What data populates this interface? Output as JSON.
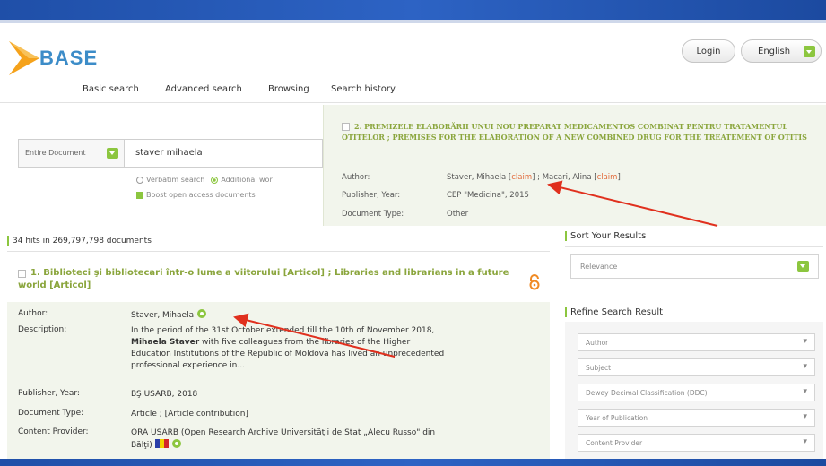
{
  "header": {
    "logo_text": "BASE",
    "login_label": "Login",
    "language_label": "English"
  },
  "nav": {
    "items": [
      "Basic search",
      "Advanced search",
      "Browsing",
      "Search history"
    ]
  },
  "search": {
    "scope": "Entire Document",
    "query": "staver mihaela",
    "options": {
      "verbatim": "Verbatim search",
      "additional": "Additional wor",
      "boost": "Boost open access documents"
    }
  },
  "overlay_record": {
    "title": "2. PREMIZELE ELABORĂRII UNUI NOU PREPARAT MEDICAMENTOS COMBINAT PENTRU TRATAMENTUL OTITELOR ; PREMISES FOR THE ELABORATION OF A NEW COMBINED DRUG FOR THE TREATEMENT OF OTITIS",
    "author_label": "Author:",
    "author_1": "Staver, Mihaela",
    "author_2": "Macari, Alina",
    "claim_label": "claim",
    "publisher_label": "Publisher, Year:",
    "publisher_value": "CEP \"Medicina\", 2015",
    "doctype_label": "Document Type:",
    "doctype_value": "Other"
  },
  "results": {
    "hits_text": "34 hits in 269,797,798 documents",
    "first": {
      "title": "1. Biblioteci şi bibliotecari într-o lume a viitorului [Articol] ; Libraries and librarians in a future world [Articol]",
      "author_label": "Author:",
      "author_value": "Staver, Mihaela",
      "description_label": "Description:",
      "description_lead": "In the period of the 31st October extended till the 10th of November 2018,",
      "description_bold": "Mihaela Staver",
      "description_rest_1": " with five colleagues from the libraries of the Higher",
      "description_rest_2": "Education Institutions of the Republic of Moldova has lived an unprecedented",
      "description_rest_3": "professional experience in...",
      "publisher_label": "Publisher, Year:",
      "publisher_value": "BŞ USARB, 2018",
      "doctype_label": "Document Type:",
      "doctype_value": "Article ; [Article contribution]",
      "provider_label": "Content Provider:",
      "provider_value_1": "ORA USARB (Open Research Archive Universităţii de Stat „Alecu Russo\" din",
      "provider_value_2": "Bălţi)"
    }
  },
  "sidebar": {
    "sort_heading": "Sort Your Results",
    "sort_value": "Relevance",
    "refine_heading": "Refine Search Result",
    "facets": [
      "Author",
      "Subject",
      "Dewey Decimal Classification (DDC)",
      "Year of Publication",
      "Content Provider"
    ]
  },
  "colors": {
    "accent_green": "#8cc63f",
    "title_green": "#8aa53c",
    "claim_orange": "#e26b3c",
    "annotation_red": "#e0301e",
    "top_band_blue": "#2d63c4"
  },
  "icons": {
    "open_access": "open-access-lock-icon",
    "dropdown": "chevron-down-icon"
  }
}
